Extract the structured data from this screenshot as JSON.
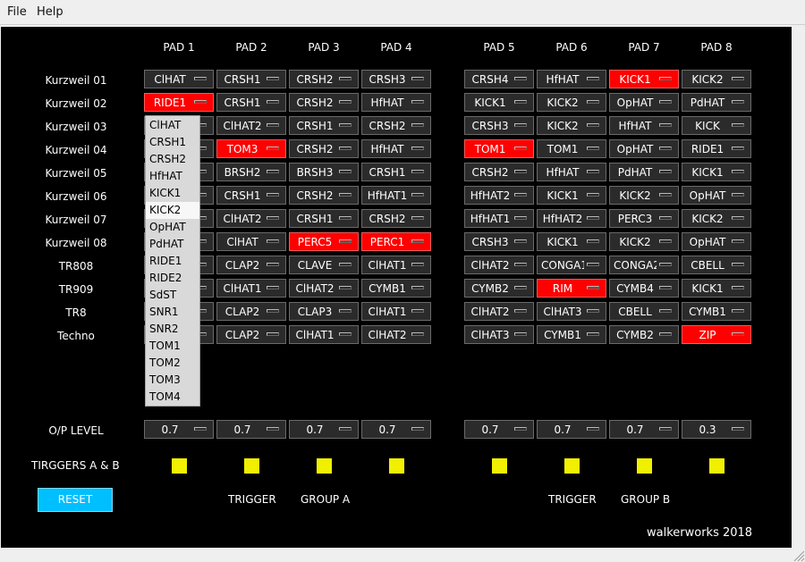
{
  "menu": {
    "file": "File",
    "help": "Help"
  },
  "colors": {
    "active": "#ff0000",
    "cell": "#2b2b2b",
    "trigger": "#f0f000",
    "reset": "#00bfff"
  },
  "pad_headers": [
    "PAD 1",
    "PAD 2",
    "PAD 3",
    "PAD 4",
    "PAD 5",
    "PAD 6",
    "PAD 7",
    "PAD 8"
  ],
  "kits": [
    {
      "name": "Kurzweil 01",
      "pads": [
        "ClHAT",
        "CRSH1",
        "CRSH2",
        "CRSH3",
        "CRSH4",
        "HfHAT",
        "KICK1",
        "KICK2"
      ],
      "active": [
        6
      ]
    },
    {
      "name": "Kurzweil 02",
      "pads": [
        "RIDE1",
        "CRSH1",
        "CRSH2",
        "HfHAT",
        "KICK1",
        "KICK2",
        "OpHAT",
        "PdHAT"
      ],
      "active": [
        0
      ]
    },
    {
      "name": "Kurzweil 03",
      "pads": [
        "",
        "ClHAT2",
        "CRSH1",
        "CRSH2",
        "CRSH3",
        "KICK2",
        "HfHAT",
        "KICK"
      ],
      "active": []
    },
    {
      "name": "Kurzweil 04",
      "pads": [
        "",
        "TOM3",
        "CRSH2",
        "HfHAT",
        "TOM1",
        "TOM1",
        "OpHAT",
        "RIDE1"
      ],
      "active": [
        1,
        4
      ]
    },
    {
      "name": "Kurzweil 05",
      "pads": [
        "",
        "BRSH2",
        "BRSH3",
        "CRSH1",
        "CRSH2",
        "HfHAT",
        "PdHAT",
        "KICK1"
      ],
      "active": []
    },
    {
      "name": "Kurzweil 06",
      "pads": [
        "",
        "CRSH1",
        "CRSH2",
        "HfHAT1",
        "HfHAT2",
        "KICK1",
        "KICK2",
        "OpHAT"
      ],
      "active": []
    },
    {
      "name": "Kurzweil 07",
      "pads": [
        "",
        "ClHAT2",
        "CRSH1",
        "CRSH2",
        "HfHAT1",
        "HfHAT2",
        "PERC3",
        "KICK2"
      ],
      "active": []
    },
    {
      "name": "Kurzweil 08",
      "pads": [
        "",
        "ClHAT",
        "PERC5",
        "PERC1",
        "CRSH3",
        "KICK1",
        "KICK2",
        "OpHAT"
      ],
      "active": [
        2,
        3
      ]
    },
    {
      "name": "TR808",
      "pads": [
        "",
        "CLAP2",
        "CLAVE",
        "ClHAT1",
        "ClHAT2",
        "CONGA1",
        "CONGA2",
        "CBELL"
      ],
      "active": []
    },
    {
      "name": "TR909",
      "pads": [
        "",
        "ClHAT1",
        "ClHAT2",
        "CYMB1",
        "CYMB2",
        "RIM",
        "CYMB4",
        "KICK1"
      ],
      "active": [
        5
      ]
    },
    {
      "name": "TR8",
      "pads": [
        "",
        "CLAP2",
        "CLAP3",
        "ClHAT1",
        "ClHAT2",
        "ClHAT3",
        "CBELL",
        "CYMB1"
      ],
      "active": []
    },
    {
      "name": "Techno",
      "pads": [
        "",
        "CLAP2",
        "ClHAT1",
        "ClHAT2",
        "ClHAT3",
        "CYMB1",
        "CYMB2",
        "ZIP"
      ],
      "active": [
        7
      ]
    }
  ],
  "dropdown": {
    "items": [
      "ClHAT",
      "CRSH1",
      "CRSH2",
      "HfHAT",
      "KICK1",
      "KICK2",
      "OpHAT",
      "PdHAT",
      "RIDE1",
      "RIDE2",
      "SdST",
      "SNR1",
      "SNR2",
      "TOM1",
      "TOM2",
      "TOM3",
      "TOM4"
    ],
    "highlighted": 5
  },
  "op_level": {
    "label": "O/P LEVEL",
    "values": [
      "0.7",
      "0.7",
      "0.7",
      "0.7",
      "0.7",
      "0.7",
      "0.7",
      "0.3"
    ]
  },
  "triggers": {
    "label": "TIRGGERS A & B"
  },
  "group_a": {
    "trigger": "TRIGGER",
    "group": "GROUP A"
  },
  "group_b": {
    "trigger": "TRIGGER",
    "group": "GROUP B"
  },
  "reset_label": "RESET",
  "footer": "walkerworks 2018"
}
